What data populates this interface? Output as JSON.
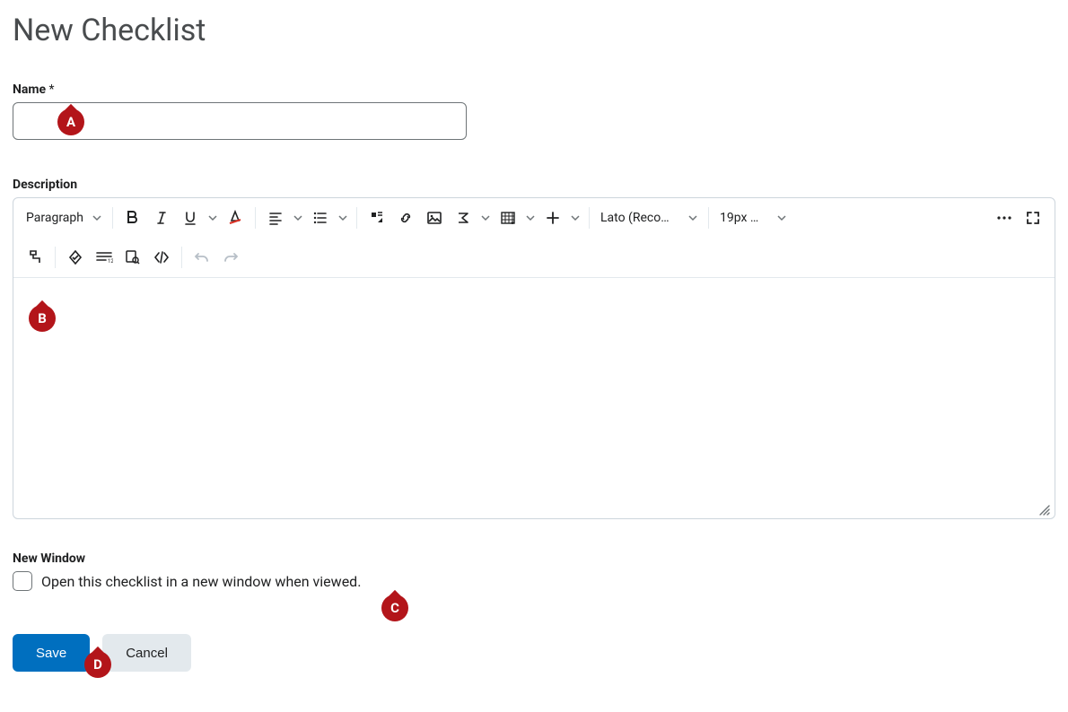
{
  "page": {
    "title": "New Checklist"
  },
  "fields": {
    "name_label": "Name",
    "name_required_marker": "*",
    "name_value": "",
    "description_label": "Description",
    "description_value": "",
    "new_window_heading": "New Window",
    "new_window_label": "Open this checklist in a new window when viewed."
  },
  "editor_toolbar": {
    "paragraph": "Paragraph",
    "font_family": "Lato (Recom…",
    "font_size": "19px …"
  },
  "actions": {
    "save": "Save",
    "cancel": "Cancel"
  },
  "annotations": {
    "a": "A",
    "b": "B",
    "c": "C",
    "d": "D"
  }
}
